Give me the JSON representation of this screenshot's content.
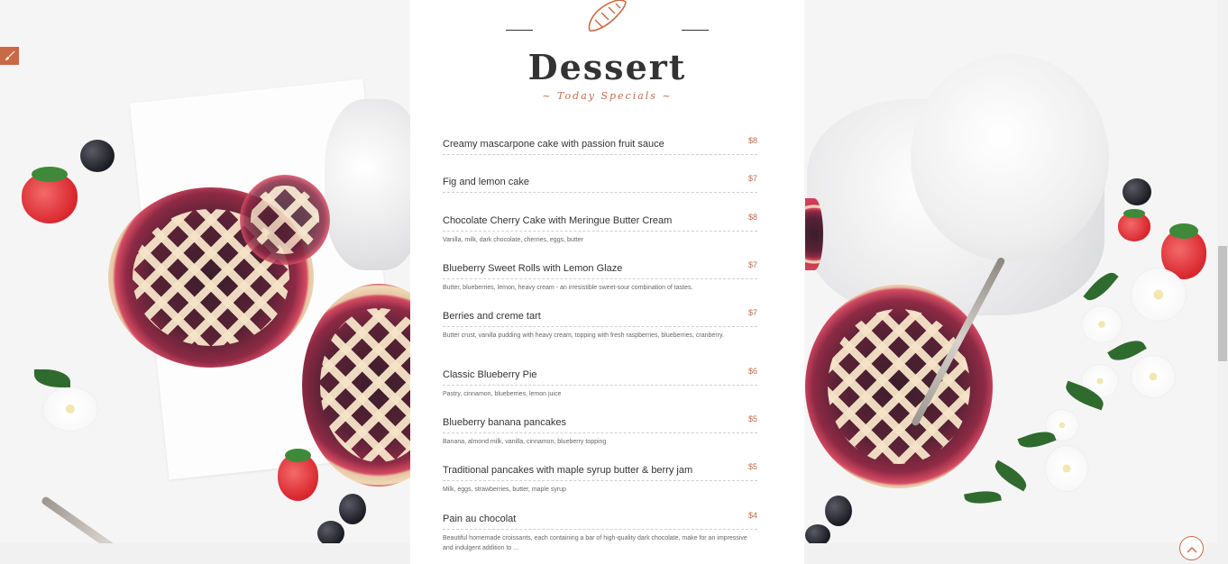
{
  "header": {
    "title": "Dessert",
    "subtitle": "~ Today Specials ~"
  },
  "menu_items": [
    {
      "name": "Creamy mascarpone cake with passion fruit sauce",
      "price": "$8",
      "description": ""
    },
    {
      "name": "Fig and lemon cake",
      "price": "$7",
      "description": ""
    },
    {
      "name": "Chocolate Cherry Cake with Meringue Butter Cream",
      "price": "$8",
      "description": "Vanilla, milk, dark chocolate, cherries, eggs, butter"
    },
    {
      "name": "Blueberry Sweet Rolls with Lemon Glaze",
      "price": "$7",
      "description": "Butter, blueberries, lemon, heavy cream - an irresistible sweet-sour combination of tastes."
    },
    {
      "name": "Berries and creme tart",
      "price": "$7",
      "description": "Butter crust, vanilla pudding with heavy cream, topping with fresh raspberries, blueberries, cranberry."
    },
    {
      "name": "Classic Blueberry Pie",
      "price": "$6",
      "description": "Pastry, cinnamon, blueberries, lemon juice"
    },
    {
      "name": "Blueberry banana pancakes",
      "price": "$5",
      "description": "Banana, almond milk, vanilla, cinnamon, blueberry topping"
    },
    {
      "name": "Traditional pancakes with maple syrup butter & berry jam",
      "price": "$5",
      "description": "Milk, eggs, strawberries, butter, maple syrup"
    },
    {
      "name": "Pain au chocolat",
      "price": "$4",
      "description": "Beautiful homemade croissants, each containing a bar of high-quality dark chocolate, make for an impressive and indulgent addition to ..."
    }
  ],
  "icons": {
    "edit": "paintbrush-icon",
    "logo": "croissant-icon",
    "scroll_top": "chevron-up-icon"
  },
  "colors": {
    "accent": "#c86a46",
    "text": "#333333",
    "card_background": "#ffffff"
  }
}
